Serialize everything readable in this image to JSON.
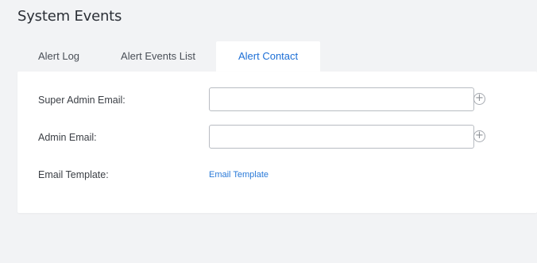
{
  "page": {
    "title": "System Events"
  },
  "tabs": [
    {
      "label": "Alert Log"
    },
    {
      "label": "Alert Events List"
    },
    {
      "label": "Alert Contact"
    }
  ],
  "active_tab": "Alert Contact",
  "form": {
    "super_admin_email": {
      "label": "Super Admin Email:",
      "value": "",
      "add_icon": "plus-circle-icon"
    },
    "admin_email": {
      "label": "Admin Email:",
      "value": "",
      "add_icon": "plus-circle-icon"
    },
    "email_template": {
      "label": "Email Template:",
      "link_text": "Email Template"
    }
  },
  "colors": {
    "accent": "#1d6fd6",
    "link": "#2a7ad8",
    "page_background": "#f2f3f5",
    "card_background": "#ffffff"
  }
}
